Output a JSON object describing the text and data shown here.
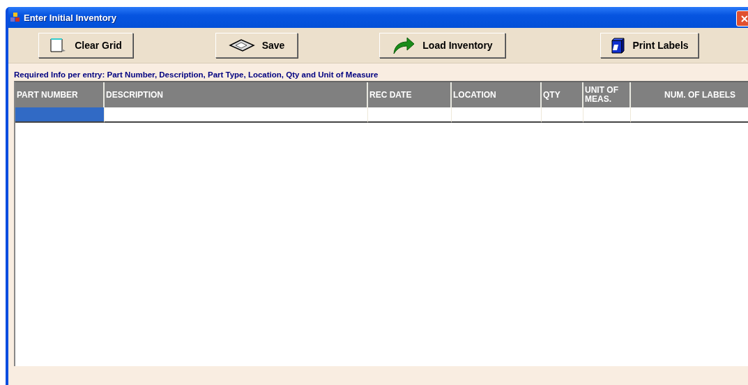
{
  "window": {
    "title": "Enter Initial Inventory"
  },
  "toolbar": [
    {
      "label": "Clear Grid"
    },
    {
      "label": "Save"
    },
    {
      "label": "Load Inventory"
    },
    {
      "label": "Print Labels"
    }
  ],
  "info": "Required Info per entry:  Part Number, Description, Part Type, Location, Qty and Unit of Measure",
  "grid": {
    "columns": [
      "PART NUMBER",
      "DESCRIPTION",
      "REC DATE",
      "LOCATION",
      "QTY",
      "UNIT OF MEAS.",
      "NUM. OF LABELS"
    ],
    "rows": [
      {
        "cells": [
          {
            "selected": true
          },
          {
            "selected": false
          },
          {
            "selected": false
          },
          {
            "selected": false
          },
          {
            "selected": false
          },
          {
            "selected": false
          },
          {
            "selected": false
          }
        ]
      }
    ]
  }
}
